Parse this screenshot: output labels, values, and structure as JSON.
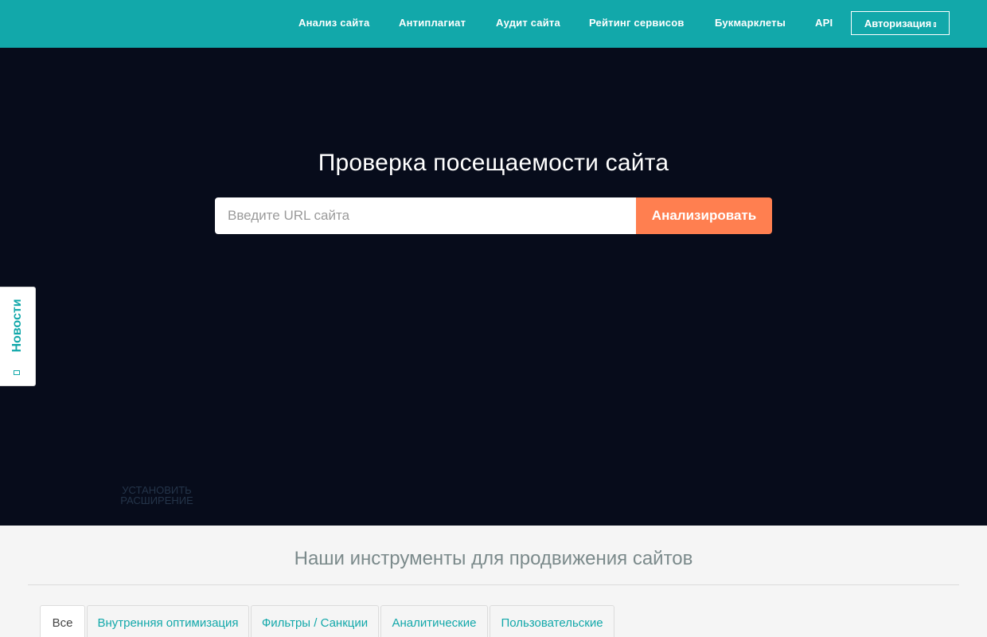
{
  "nav": {
    "links": [
      "Анализ сайта",
      "Антиплагиат",
      "Аудит сайта",
      "Рейтинг сервисов",
      "Букмарклеты",
      "API"
    ],
    "auth_label": "Авторизация"
  },
  "hero": {
    "title": "Проверка посещаемости сайта",
    "url_placeholder": "Введите URL сайта",
    "url_value": "",
    "analyze_label": "Анализировать",
    "news_label": "Новости",
    "extension_line1": "Установить",
    "extension_line2": "расширение"
  },
  "tools": {
    "title": "Наши инструменты для продвижения сайтов",
    "tabs": [
      "Все",
      "Внутренняя оптимизация",
      "Фильтры / Санкции",
      "Аналитические",
      "Пользовательские"
    ],
    "active_tab": "Все"
  },
  "colors": {
    "brand": "#12a8aa",
    "hero_bg": "#070c1b",
    "accent": "#ff7f50"
  }
}
